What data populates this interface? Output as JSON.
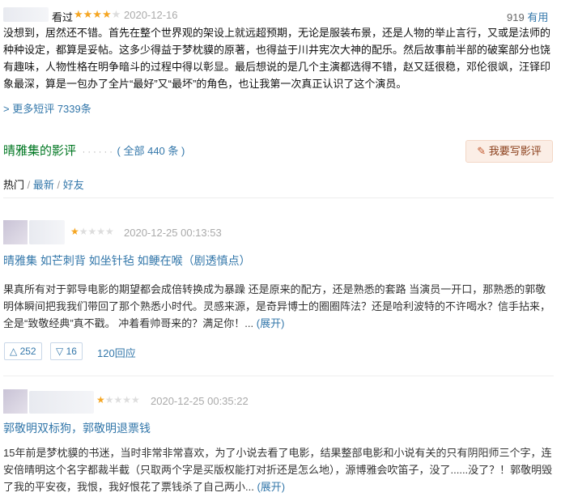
{
  "top_review": {
    "status": "看过",
    "rating_stars": 4,
    "date": "2020-12-16",
    "useful_count": "919",
    "useful_label": "有用",
    "text": "没想到，居然还不错。首先在整个世界观的架设上就远超预期，无论是服装布景，还是人物的举止言行，又或是法师的种种设定，都算是妥帖。这多少得益于梦枕貘的原著，也得益于川井宪次大神的配乐。然后故事前半部的破案部分也饶有趣味，人物性格在明争暗斗的过程中得以彰显。最后想说的是几个主演都选得不错，赵又廷很稳，邓伦很飒，汪铎印象最深，算是一包办了全片“最好”又“最坏”的角色，也让我第一次真正认识了这个演员。"
  },
  "more_short": "> 更多短评 7339条",
  "reviews_section": {
    "title": "晴雅集的影评",
    "dots": "· · · · · ·",
    "count": "( 全部 440 条 )",
    "write_button": "我要写影评",
    "sort": [
      "热门",
      "最新",
      "好友"
    ]
  },
  "review1": {
    "date": "2020-12-25 00:13:53",
    "rating_stars": 1,
    "title": "晴雅集 如芒刺背 如坐针毡 如鲠在喉（剧透慎点）",
    "text": "果真所有对于郭导电影的期望都会成倍转换成为暴躁 还是原来的配方，还是熟悉的套路 当演员一开口，那熟悉的郭敬明体瞬间把我我们带回了那个熟悉小时代。灵感来源，是奇异博士的圈圈阵法？还是哈利波特的不许喝水？信手拈来，全是“致敬经典”真不戳。 冲着看帅哥来的？满足你！...",
    "expand": "(展开)",
    "up": "252",
    "down": "16",
    "replies": "120回应"
  },
  "review2": {
    "date": "2020-12-25 00:35:22",
    "rating_stars": 1,
    "title": "郭敬明双标狗，郭敬明退票钱",
    "text": "15年前是梦枕貘的书迷，当时非常非常喜欢，为了小说去看了电影，结果整部电影和小说有关的只有阴阳师三个字，连安倍晴明这个名字都裁半截（只取两个字是买版权能打对折还是怎么地），源博雅会吹笛子，没了......没了？！郭敬明毁了我的平安夜，我恨，我好恨花了票钱杀了自己两小...",
    "expand": "(展开)"
  },
  "colors": {
    "link": "#3377aa",
    "section_green": "#007722",
    "star": "#f5a623"
  },
  "icons": {
    "up": "triangle-up-icon",
    "down": "triangle-down-icon",
    "write": "pencil-icon"
  }
}
